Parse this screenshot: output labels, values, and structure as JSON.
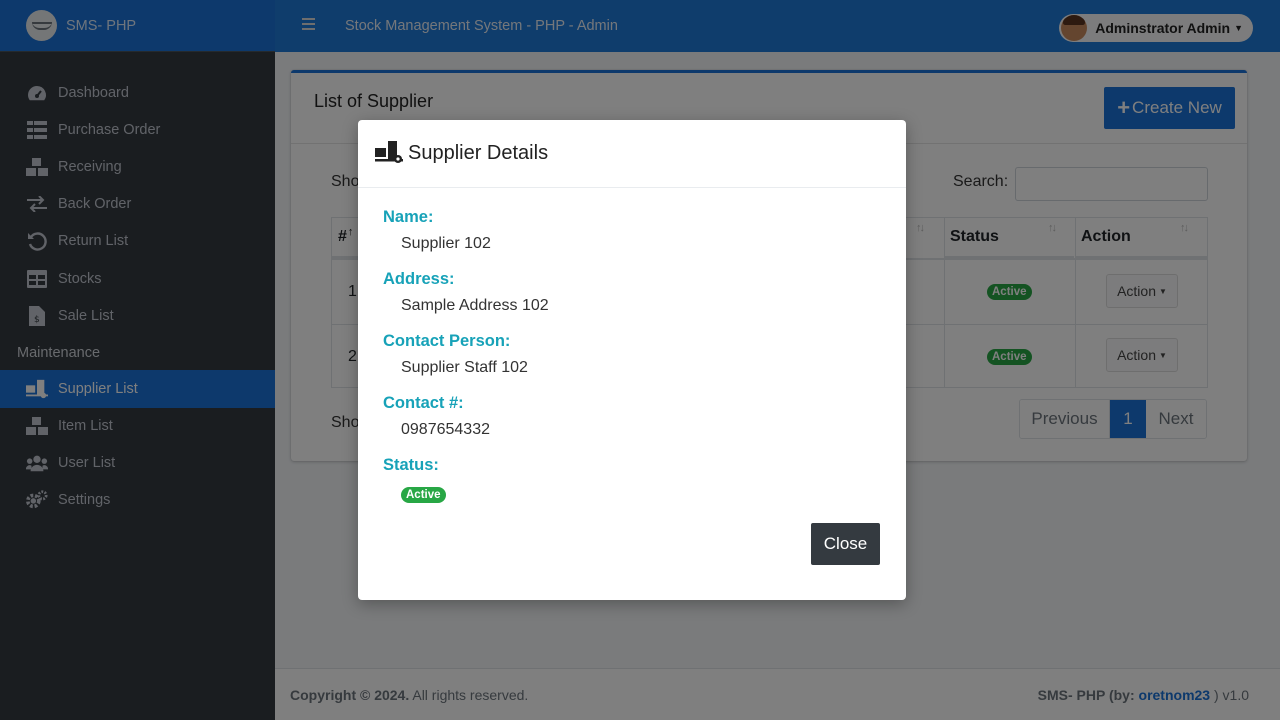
{
  "brand": {
    "text": "SMS- PHP"
  },
  "header": {
    "title": "Stock Management System - PHP - Admin",
    "user": "Adminstrator Admin"
  },
  "sidebar": {
    "items": [
      {
        "label": "Dashboard",
        "icon": "tachometer-icon"
      },
      {
        "label": "Purchase Order",
        "icon": "table-list-icon"
      },
      {
        "label": "Receiving",
        "icon": "boxes-icon"
      },
      {
        "label": "Back Order",
        "icon": "exchange-icon"
      },
      {
        "label": "Return List",
        "icon": "undo-icon"
      },
      {
        "label": "Stocks",
        "icon": "table-icon"
      },
      {
        "label": "Sale List",
        "icon": "file-invoice-icon"
      }
    ],
    "section": "Maintenance",
    "maintenance": [
      {
        "label": "Supplier List",
        "icon": "truck-loading-icon",
        "active": true
      },
      {
        "label": "Item List",
        "icon": "boxes-icon"
      },
      {
        "label": "User List",
        "icon": "users-icon"
      },
      {
        "label": "Settings",
        "icon": "cogs-icon"
      }
    ]
  },
  "card": {
    "title": "List of Supplier",
    "create_label": "Create New",
    "show_top": "Sho",
    "show_bottom": "Sho",
    "search_label": "Search:",
    "search_value": "",
    "columns": {
      "num": "#",
      "status": "Status",
      "action": "Action"
    },
    "rows": [
      {
        "num": "1",
        "status": "Active",
        "action": "Action"
      },
      {
        "num": "2",
        "status": "Active",
        "action": "Action"
      }
    ],
    "pagination": {
      "prev": "Previous",
      "current": "1",
      "next": "Next"
    }
  },
  "modal": {
    "title": "Supplier Details",
    "fields": [
      {
        "label": "Name:",
        "value": "Supplier 102"
      },
      {
        "label": "Address:",
        "value": "Sample Address 102"
      },
      {
        "label": "Contact Person:",
        "value": "Supplier Staff 102"
      },
      {
        "label": "Contact #:",
        "value": "0987654332"
      }
    ],
    "status_label": "Status:",
    "status_value": "Active",
    "close_label": "Close"
  },
  "footer": {
    "copyright": "Copyright © 2024.",
    "rights": "All rights reserved.",
    "credit_prefix": "SMS- PHP (by:",
    "credit_link": "oretnom23",
    "credit_suffix": ") v1.0"
  },
  "colors": {
    "primary": "#1a73d9",
    "success": "#28a745",
    "info": "#17a2b8",
    "dark": "#343a40"
  }
}
